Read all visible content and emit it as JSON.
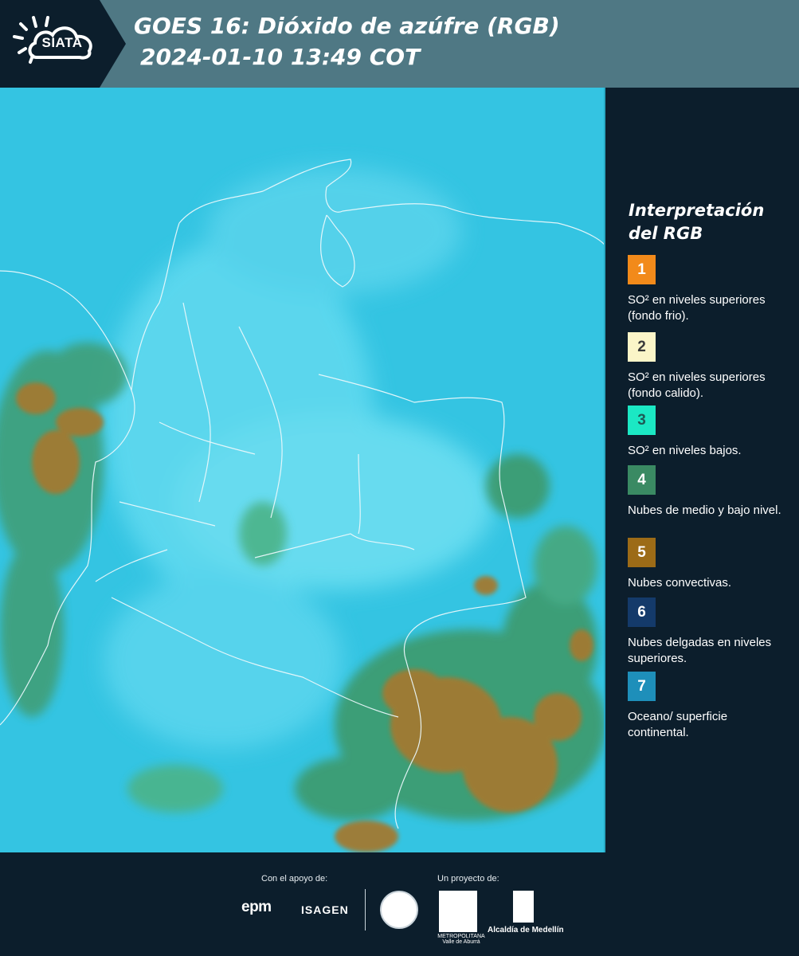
{
  "header": {
    "logo_text": "SIATA",
    "title_line1": "GOES 16: Dióxido de azúfre (RGB)",
    "title_line2": "2024-01-10 13:49 COT"
  },
  "colors": {
    "header_bg": "#4f7884",
    "panel_bg": "#0c1e2c",
    "map_base": "#33c6e4",
    "cloud_green": "#3e9a6c",
    "cloud_brown": "#a07a2e"
  },
  "legend": {
    "title": "Interpretación del RGB",
    "items": [
      {
        "number": "1",
        "color": "#f28a1a",
        "text": "SO² en niveles superiores (fondo frio)."
      },
      {
        "number": "2",
        "color": "#fbf5c8",
        "text": "SO² en niveles superiores (fondo calido)."
      },
      {
        "number": "3",
        "color": "#1be8c4",
        "text": "SO² en niveles bajos."
      },
      {
        "number": "4",
        "color": "#3a8a63",
        "text": "Nubes de medio y bajo nivel."
      },
      {
        "number": "5",
        "color": "#9c6b17",
        "text": "Nubes convectivas."
      },
      {
        "number": "6",
        "color": "#143a6a",
        "text": "Nubes delgadas en niveles superiores."
      },
      {
        "number": "7",
        "color": "#1e8fba",
        "text": "Oceano/ superficie continental."
      }
    ]
  },
  "footer": {
    "support_label": "Con el apoyo de:",
    "project_label": "Un proyecto de:",
    "sponsor1": "epm",
    "sponsor2": "ISAGEN",
    "area_caption": "METROPOLITANA Valle de Aburrá",
    "alcaldia": "Alcaldía de Medellín"
  }
}
